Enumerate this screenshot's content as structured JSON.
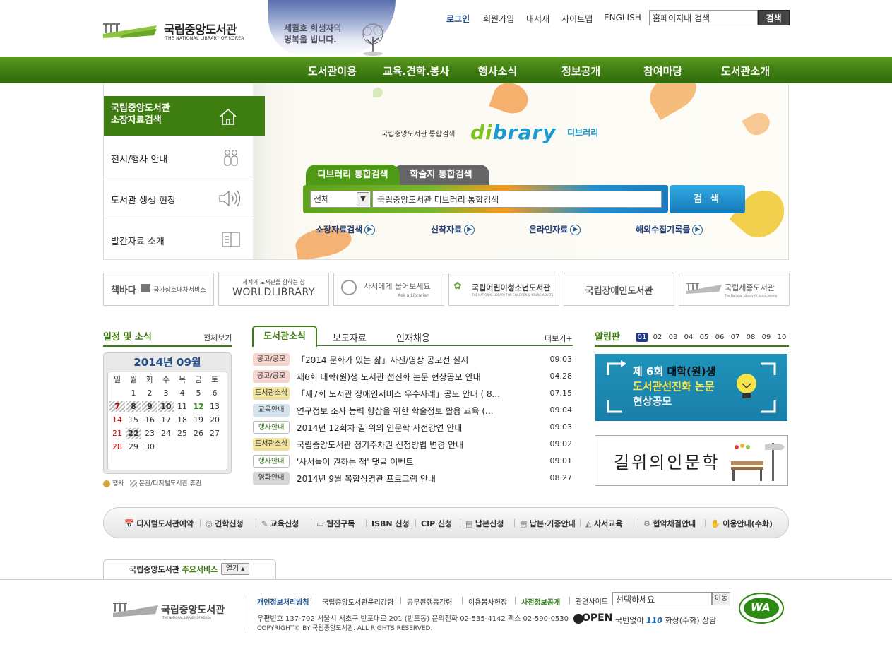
{
  "header": {
    "logo_ko": "국립중앙도서관",
    "logo_en": "THE NATIONAL LIBRARY OF KOREA",
    "banner_line1": "세월호 희생자의",
    "banner_line2": "명복을 빕니다.",
    "links": [
      "로그인",
      "회원가입",
      "내서재",
      "사이트맵",
      "ENGLISH"
    ],
    "search_value": "홈페이지내 검색",
    "search_button": "검색"
  },
  "gnb": [
    "도서관이용",
    "교육.견학.봉사",
    "행사소식",
    "정보공개",
    "참여마당",
    "도서관소개"
  ],
  "leftmenu": {
    "active_line1": "국립중앙도서관",
    "active_line2": "소장자료검색",
    "items": [
      "전시/행사 안내",
      "도서관 생생 현장",
      "발간자료 소개"
    ]
  },
  "dibrary": {
    "label": "국립중앙도서관 통합검색",
    "logo_d": "di",
    "logo_rest": "brary",
    "logo_kor": "디브러리",
    "tab1": "디브러리 통합검색",
    "tab2": "학술지 통합검색",
    "select_value": "전체",
    "query_value": "국립중앙도서관 디브러리 통합검색",
    "search_button": "검 색",
    "quick_links": [
      "소장자료검색",
      "신착자료",
      "온라인자료",
      "해외수집기록물"
    ]
  },
  "banners": [
    {
      "line1": "책바다",
      "line2": "국가상호대차서비스"
    },
    {
      "line1": "세계의 도서관을 향하는 창",
      "line2": "WORLDLIBRARY"
    },
    {
      "line1": "사서에게 물어보세요",
      "line2": "Ask a Librarian"
    },
    {
      "line1": "국립어린이청소년도서관",
      "line2": "THE NATIONAL LIBRARY FOR CHILDREN & YOUNG ADULTS"
    },
    {
      "line1": "국립장애인도서관",
      "line2": ""
    },
    {
      "line1": "국립세종도서관",
      "line2": "The National Library Of Korea,Sejong"
    }
  ],
  "schedule": {
    "title": "일정 및 소식",
    "more": "전체보기",
    "month": "2014년 09월",
    "weekdays": [
      "일",
      "월",
      "화",
      "수",
      "목",
      "금",
      "토"
    ],
    "legend_event": "행사",
    "legend_closed": "본관/디지털도서관 휴관"
  },
  "news": {
    "tabs": [
      "도서관소식",
      "보도자료",
      "인재채용"
    ],
    "more": "더보기+",
    "items": [
      {
        "badge": "공고/공모",
        "text": "「2014 문화가 있는 삶」사진/영상 공모전 실시",
        "date": "09.03"
      },
      {
        "badge": "공고/공모",
        "text": "제6회 대학(원)생 도서관 선진화 논문 현상공모 안내",
        "date": "04.28"
      },
      {
        "badge": "도서관소식",
        "text": "「제7회 도서관 장애인서비스 우수사례」공모 안내 ( 8...",
        "date": "07.15"
      },
      {
        "badge": "교육안내",
        "text": "연구정보 조사 능력 향상을 위한 학술정보 활용 교육 (...",
        "date": "09.04"
      },
      {
        "badge": "행사안내",
        "text": "2014년 12회차 길 위의 인문학 사전강연 안내",
        "date": "09.03"
      },
      {
        "badge": "도서관소식",
        "text": "국립중앙도서관 정기주차권 신청방법 변경 안내",
        "date": "09.02"
      },
      {
        "badge": "행사안내",
        "text": "'사서들이 권하는 책' 댓글 이벤트",
        "date": "09.01"
      },
      {
        "badge": "영화안내",
        "text": "2014년 9월 복합상영관 프로그램 안내",
        "date": "08.27"
      }
    ]
  },
  "noticeboard": {
    "title": "알림판",
    "pages": [
      "01",
      "02",
      "03",
      "04",
      "05",
      "06",
      "07",
      "08",
      "09",
      "10"
    ],
    "card1_line1a": "제 6회 ",
    "card1_line1b": "대학(원)생",
    "card1_line2": "도서관선진화 논문",
    "card1_line3": "현상공모",
    "card2_text": "길위의인문학"
  },
  "quick_services": [
    "디지털도서관예약",
    "견학신청",
    "교육신청",
    "웹진구독",
    "ISBN 신청",
    "CIP 신청",
    "납본신청",
    "납본·기증안내",
    "사서교육",
    "협약체결안내",
    "이용안내(수화)"
  ],
  "main_service": {
    "label_a": "국립중앙도서관 ",
    "label_b": "주요서비스",
    "button": "열기 ▴"
  },
  "footer": {
    "logo_ko": "국립중앙도서관",
    "logo_en": "THE NATIONAL LIBRARY OF KOREA",
    "links": [
      "개인정보처리방침",
      "국립중앙도서관윤리강령",
      "공무원행동강령",
      "이용봉사헌장",
      "사전정보공개"
    ],
    "related_label": "관련사이트",
    "related_select": "선택하세요",
    "move_button": "이동",
    "address": "우편번호 137-702 서울시 서초구 반포대로 201 (반포동)   문의전화 02-535-4142  팩스 02-590-0530",
    "copyright": "COPYRIGHT© BY 국립중앙도서관. ALL RIGHTS RESERVED.",
    "open_label": "OPEN",
    "call_a": "국번없이 ",
    "call_b": "110",
    "call_c": " 화상(수화) 상담",
    "wa_label": "WA"
  }
}
